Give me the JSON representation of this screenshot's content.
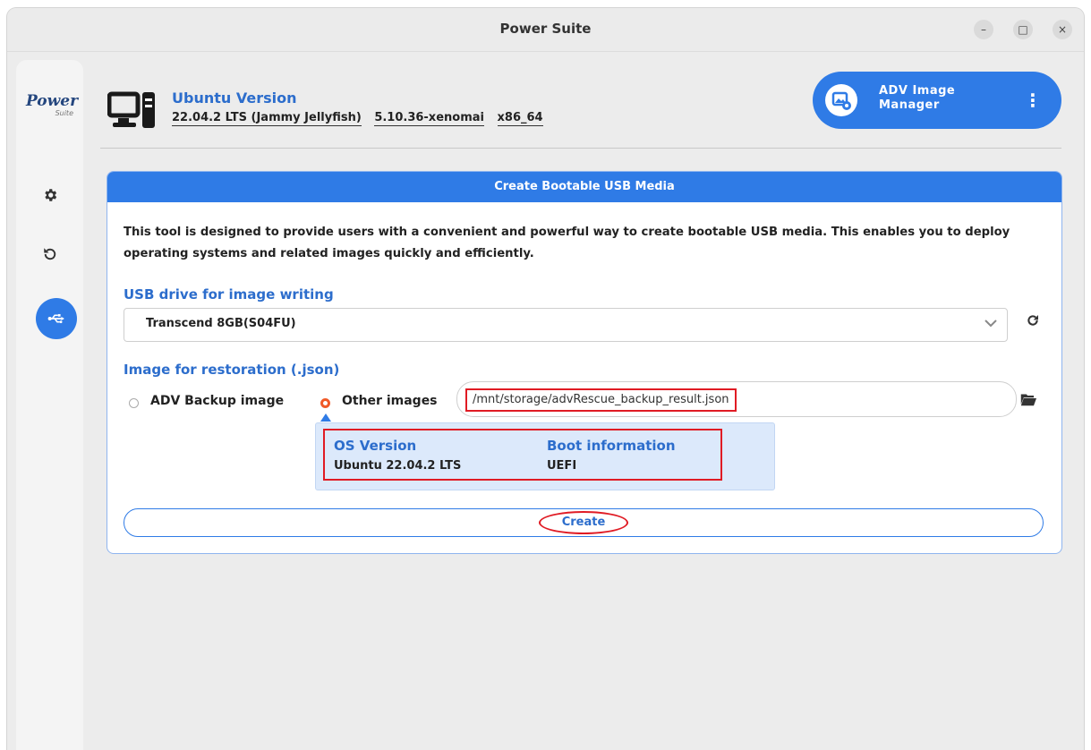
{
  "window": {
    "title": "Power Suite",
    "minimize_glyph": "–",
    "maximize_glyph": "□",
    "close_glyph": "×"
  },
  "sidebar": {
    "logo_main": "Power",
    "logo_sub": "Suite",
    "items": [
      {
        "icon": "gear-icon",
        "glyph": "✱"
      },
      {
        "icon": "restore-icon",
        "glyph": "↺"
      },
      {
        "icon": "usb-icon",
        "glyph": "⭠",
        "active": true
      }
    ]
  },
  "header": {
    "section_title": "Ubuntu Version",
    "os_release": "22.04.2 LTS (Jammy Jellyfish)",
    "kernel": "5.10.36-xenomai",
    "arch": "x86_64",
    "app_button_line1": "ADV Image",
    "app_button_line2": "Manager",
    "app_button_menu": "⋮"
  },
  "panel": {
    "title": "Create Bootable USB Media",
    "description": "This tool is designed to provide users with a convenient and powerful way to create bootable USB media. This enables you to deploy operating systems and related images quickly and efficiently.",
    "usb_label": "USB drive for image writing",
    "usb_selected": "Transcend 8GB(S04FU)",
    "image_label": "Image for restoration (.json)",
    "radio_backup": "ADV Backup image",
    "radio_other": "Other images",
    "radio_selected": "Other images",
    "image_path": "/mnt/storage/advRescue_backup_result.json",
    "info": {
      "os_header": "OS Version",
      "os_value": "Ubuntu 22.04.2 LTS",
      "boot_header": "Boot information",
      "boot_value": "UEFI"
    },
    "create_label": "Create"
  },
  "colors": {
    "accent": "#2f7be6",
    "highlight": "#e01b24",
    "radio_selected": "#f05a28"
  }
}
